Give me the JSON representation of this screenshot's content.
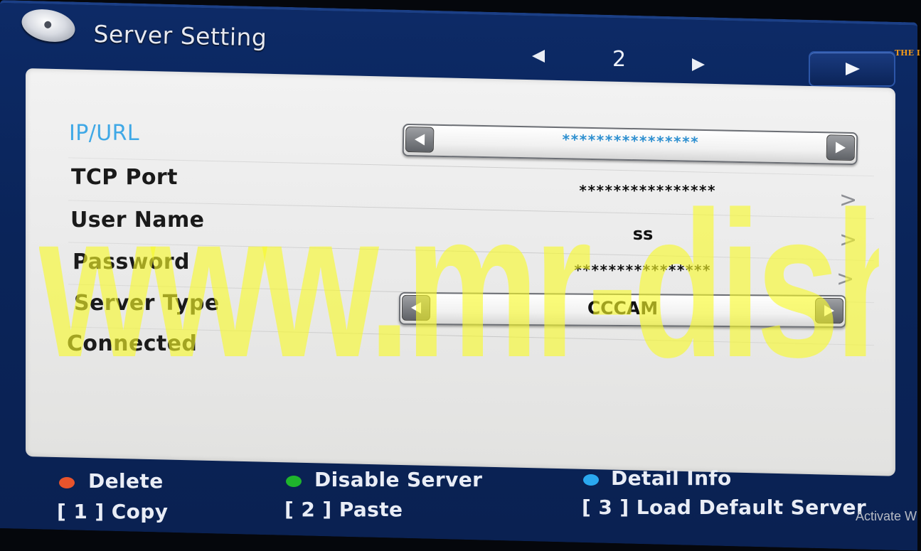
{
  "header": {
    "title": "Server Setting",
    "page_number": "2",
    "corner_logo": "THE I"
  },
  "form": {
    "rows": [
      {
        "label": "IP/URL",
        "value": "****************",
        "control": "selector",
        "active": true
      },
      {
        "label": "TCP Port",
        "value": "****************",
        "control": "text"
      },
      {
        "label": "User Name",
        "value": "ss",
        "control": "text"
      },
      {
        "label": "Password",
        "value": "****************",
        "control": "text"
      },
      {
        "label": "Server Type",
        "value": "CCCAM",
        "control": "selector"
      },
      {
        "label": "Connected",
        "value": "",
        "control": "none"
      }
    ],
    "chevron": ">"
  },
  "watermark": "www.mr-dish.com",
  "legend": {
    "delete": "Delete",
    "disable_server": "Disable Server",
    "detail_info": "Detail Info",
    "copy": "[ 1 ] Copy",
    "paste": "[ 2 ] Paste",
    "load_default": "[ 3 ] Load Default Server"
  },
  "colors": {
    "delete_dot": "#e8542c",
    "disable_dot": "#1fb52c",
    "detail_dot": "#2aa8ef",
    "active_label": "#3fa8e6",
    "watermark": "#f8fa28"
  },
  "overlay_text": "Activate W"
}
